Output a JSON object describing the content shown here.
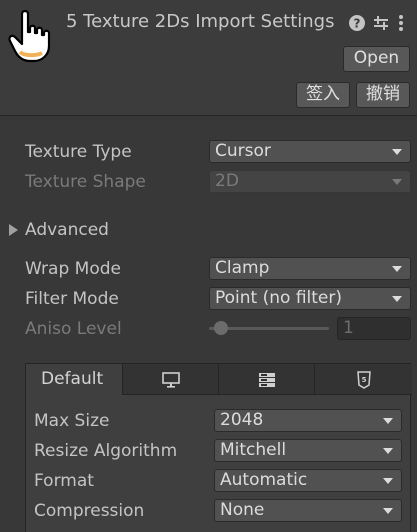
{
  "header": {
    "title": "5 Texture 2Ds Import Settings",
    "open_label": "Open",
    "apply_label": "签入",
    "revert_label": "撤销",
    "icons": [
      "cursor-hand-icon",
      "help-icon",
      "preset-settings-icon",
      "kebab-menu-icon"
    ]
  },
  "settings": {
    "texture_type": {
      "label": "Texture Type",
      "value": "Cursor"
    },
    "texture_shape": {
      "label": "Texture Shape",
      "value": "2D"
    },
    "advanced_label": "Advanced",
    "wrap_mode": {
      "label": "Wrap Mode",
      "value": "Clamp"
    },
    "filter_mode": {
      "label": "Filter Mode",
      "value": "Point (no filter)"
    },
    "aniso_level": {
      "label": "Aniso Level",
      "value": "1"
    }
  },
  "platform": {
    "tabs": [
      {
        "label": "Default",
        "icon": null
      },
      {
        "label": "",
        "icon": "monitor-icon"
      },
      {
        "label": "",
        "icon": "server-icon"
      },
      {
        "label": "",
        "icon": "html5-icon"
      }
    ],
    "max_size": {
      "label": "Max Size",
      "value": "2048"
    },
    "resize_algorithm": {
      "label": "Resize Algorithm",
      "value": "Mitchell"
    },
    "format": {
      "label": "Format",
      "value": "Automatic"
    },
    "compression": {
      "label": "Compression",
      "value": "None"
    }
  }
}
